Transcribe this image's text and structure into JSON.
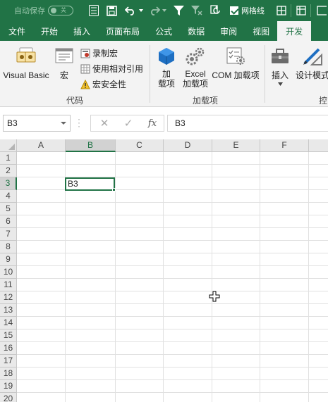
{
  "qat": {
    "autosave_label": "自动保存",
    "autosave_state": "关",
    "gridlines_label": "网格线",
    "gridlines_checked": true
  },
  "tabs": [
    "文件",
    "开始",
    "插入",
    "页面布局",
    "公式",
    "数据",
    "审阅",
    "视图",
    "开发"
  ],
  "active_tab": "开发",
  "ribbon": {
    "code_group": {
      "label": "代码",
      "visual_basic": "Visual Basic",
      "macros": "宏",
      "record_macro": "录制宏",
      "relative_ref": "使用相对引用",
      "macro_security": "宏安全性"
    },
    "addins_group": {
      "label": "加载项",
      "addins_line1": "加",
      "addins_line2": "载项",
      "excel_addins_line1": "Excel",
      "excel_addins_line2": "加载项",
      "com_addins": "COM 加载项"
    },
    "controls_group": {
      "label": "控",
      "insert": "插入",
      "design_mode": "设计模式"
    }
  },
  "formula_bar": {
    "name_box": "B3",
    "formula_value": "B3"
  },
  "grid": {
    "columns": [
      "A",
      "B",
      "C",
      "D",
      "E",
      "F"
    ],
    "rows": [
      "1",
      "2",
      "3",
      "4",
      "5",
      "6",
      "7",
      "8",
      "9",
      "10",
      "11",
      "12",
      "13",
      "14",
      "15",
      "16",
      "17",
      "18",
      "19",
      "20"
    ],
    "selected_column": "B",
    "selected_row": "3",
    "active_cell_value": "B3"
  },
  "colors": {
    "brand": "#217346",
    "ribbon_bg": "#f3f3f3"
  }
}
